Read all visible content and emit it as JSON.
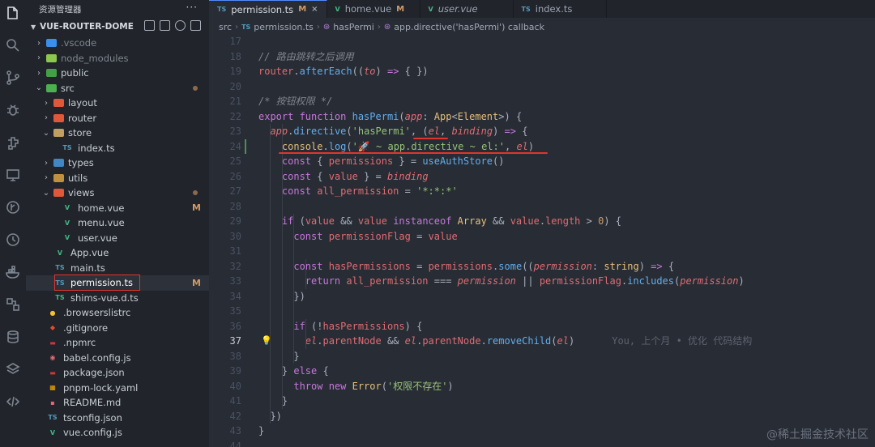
{
  "sidebar": {
    "title": "资源管理器",
    "more": "···",
    "project": "VUE-ROUTER-DOME",
    "tree": [
      {
        "label": ".vscode",
        "chev": "›",
        "icon": "vscode-folder-icon",
        "icon_text": "",
        "icon_color": "#3b8eea",
        "dim": true,
        "level": 1
      },
      {
        "label": "node_modules",
        "chev": "›",
        "icon": "node-folder-icon",
        "icon_text": "",
        "icon_color": "#8cc84b",
        "dim": true,
        "level": 1
      },
      {
        "label": "public",
        "chev": "›",
        "icon": "public-folder-icon",
        "icon_text": "",
        "icon_color": "#43a047",
        "level": 1
      },
      {
        "label": "src",
        "chev": "⌄",
        "icon": "src-folder-icon",
        "icon_text": "",
        "icon_color": "#4caf50",
        "level": 1,
        "dot": true
      },
      {
        "label": "layout",
        "chev": "›",
        "icon": "layout-folder-icon",
        "icon_text": "",
        "icon_color": "#e0583a",
        "level": 2
      },
      {
        "label": "router",
        "chev": "›",
        "icon": "router-folder-icon",
        "icon_text": "",
        "icon_color": "#e0583a",
        "level": 2
      },
      {
        "label": "store",
        "chev": "⌄",
        "icon": "store-folder-icon",
        "icon_text": "",
        "icon_color": "#c0a060",
        "level": 2
      },
      {
        "label": "index.ts",
        "chev": "",
        "icon": "typescript-file-icon",
        "icon_text": "TS",
        "icon_color": "#519aba",
        "level": 3
      },
      {
        "label": "types",
        "chev": "›",
        "icon": "types-folder-icon",
        "icon_text": "",
        "icon_color": "#3f88c5",
        "level": 2
      },
      {
        "label": "utils",
        "chev": "›",
        "icon": "utils-folder-icon",
        "icon_text": "",
        "icon_color": "#c09040",
        "level": 2
      },
      {
        "label": "views",
        "chev": "⌄",
        "icon": "views-folder-icon",
        "icon_text": "",
        "icon_color": "#e0583a",
        "level": 2,
        "dot": true
      },
      {
        "label": "home.vue",
        "chev": "",
        "icon": "vue-file-icon",
        "icon_text": "V",
        "icon_color": "#41b883",
        "level": 3,
        "badge": "M"
      },
      {
        "label": "menu.vue",
        "chev": "",
        "icon": "vue-file-icon",
        "icon_text": "V",
        "icon_color": "#41b883",
        "level": 3
      },
      {
        "label": "user.vue",
        "chev": "",
        "icon": "vue-file-icon",
        "icon_text": "V",
        "icon_color": "#41b883",
        "level": 3
      },
      {
        "label": "App.vue",
        "chev": "",
        "icon": "vue-file-icon",
        "icon_text": "V",
        "icon_color": "#41b883",
        "level": 2
      },
      {
        "label": "main.ts",
        "chev": "",
        "icon": "typescript-file-icon",
        "icon_text": "TS",
        "icon_color": "#519aba",
        "level": 2
      },
      {
        "label": "permission.ts",
        "chev": "",
        "icon": "typescript-file-icon",
        "icon_text": "TS",
        "icon_color": "#519aba",
        "level": 2,
        "badge": "M",
        "selected": true
      },
      {
        "label": "shims-vue.d.ts",
        "chev": "",
        "icon": "typescript-def-icon",
        "icon_text": "TS",
        "icon_color": "#41b883",
        "level": 2
      },
      {
        "label": ".browserslistrc",
        "chev": "",
        "icon": "browserslist-icon",
        "icon_text": "●",
        "icon_color": "#f2c12e",
        "level": 1
      },
      {
        "label": ".gitignore",
        "chev": "",
        "icon": "git-icon",
        "icon_text": "◆",
        "icon_color": "#e44d26",
        "level": 1
      },
      {
        "label": ".npmrc",
        "chev": "",
        "icon": "npm-icon",
        "icon_text": "▬",
        "icon_color": "#cb3837",
        "level": 1
      },
      {
        "label": "babel.config.js",
        "chev": "",
        "icon": "babel-icon",
        "icon_text": "◉",
        "icon_color": "#e06c75",
        "level": 1
      },
      {
        "label": "package.json",
        "chev": "",
        "icon": "npm-package-icon",
        "icon_text": "▬",
        "icon_color": "#cb3837",
        "level": 1
      },
      {
        "label": "pnpm-lock.yaml",
        "chev": "",
        "icon": "pnpm-icon",
        "icon_text": "▦",
        "icon_color": "#f9ad00",
        "level": 1
      },
      {
        "label": "README.md",
        "chev": "",
        "icon": "readme-icon",
        "icon_text": "▪",
        "icon_color": "#e06c75",
        "level": 1
      },
      {
        "label": "tsconfig.json",
        "chev": "",
        "icon": "tsconfig-icon",
        "icon_text": "TS",
        "icon_color": "#519aba",
        "level": 1
      },
      {
        "label": "vue.config.js",
        "chev": "",
        "icon": "vue-config-icon",
        "icon_text": "V",
        "icon_color": "#41b883",
        "level": 1
      }
    ]
  },
  "tabs": [
    {
      "label": "permission.ts",
      "icon_text": "TS",
      "icon_color": "#519aba",
      "badge": "M",
      "active": true,
      "close": "×"
    },
    {
      "label": "home.vue",
      "icon_text": "V",
      "icon_color": "#41b883",
      "badge": "M"
    },
    {
      "label": "user.vue",
      "icon_text": "V",
      "icon_color": "#41b883",
      "italic": true
    },
    {
      "label": "index.ts",
      "icon_text": "TS",
      "icon_color": "#519aba"
    }
  ],
  "breadcrumb": {
    "segments": [
      "src",
      "permission.ts",
      "hasPermi",
      "app.directive('hasPermi') callback"
    ],
    "ts_icon": "TS"
  },
  "code": {
    "blame": "You, 上个月 • 优化 代码结构",
    "lines": [
      {
        "n": "17",
        "tokens": []
      },
      {
        "n": "18",
        "tokens": [
          [
            "com",
            "// 路由跳转之后调用"
          ]
        ]
      },
      {
        "n": "19",
        "tokens": [
          [
            "var",
            "router"
          ],
          [
            "plain",
            "."
          ],
          [
            "fn",
            "afterEach"
          ],
          [
            "plain",
            "(("
          ],
          [
            "param",
            "to"
          ],
          [
            "plain",
            ") "
          ],
          [
            "kw",
            "=>"
          ],
          [
            "plain",
            " { })"
          ]
        ]
      },
      {
        "n": "20",
        "tokens": []
      },
      {
        "n": "21",
        "tokens": [
          [
            "com",
            "/* 按钮权限 */"
          ]
        ]
      },
      {
        "n": "22",
        "tokens": [
          [
            "kw",
            "export function "
          ],
          [
            "fn",
            "hasPermi"
          ],
          [
            "plain",
            "("
          ],
          [
            "param",
            "app"
          ],
          [
            "plain",
            ": "
          ],
          [
            "type",
            "App"
          ],
          [
            "plain",
            "<"
          ],
          [
            "type",
            "Element"
          ],
          [
            "plain",
            ">) {"
          ]
        ]
      },
      {
        "n": "23",
        "tokens": [
          [
            "plain",
            "  "
          ],
          [
            "param",
            "app"
          ],
          [
            "plain",
            "."
          ],
          [
            "fn",
            "directive"
          ],
          [
            "plain",
            "("
          ],
          [
            "str",
            "'hasPermi'"
          ],
          [
            "plain",
            ", ("
          ],
          [
            "param",
            "el"
          ],
          [
            "plain",
            ", "
          ],
          [
            "param",
            "binding"
          ],
          [
            "plain",
            ") "
          ],
          [
            "kw",
            "=>"
          ],
          [
            "plain",
            " {"
          ]
        ]
      },
      {
        "n": "24",
        "tokens": [
          [
            "plain",
            "    "
          ],
          [
            "type",
            "console"
          ],
          [
            "plain",
            "."
          ],
          [
            "fn",
            "log"
          ],
          [
            "plain",
            "("
          ],
          [
            "str",
            "'🚀 ~ app.directive ~ el:'"
          ],
          [
            "plain",
            ", "
          ],
          [
            "param",
            "el"
          ],
          [
            "plain",
            ")"
          ]
        ]
      },
      {
        "n": "25",
        "tokens": [
          [
            "plain",
            "    "
          ],
          [
            "kw",
            "const"
          ],
          [
            "plain",
            " { "
          ],
          [
            "var",
            "permissions"
          ],
          [
            "plain",
            " } = "
          ],
          [
            "fn",
            "useAuthStore"
          ],
          [
            "plain",
            "()"
          ]
        ]
      },
      {
        "n": "26",
        "tokens": [
          [
            "plain",
            "    "
          ],
          [
            "kw",
            "const"
          ],
          [
            "plain",
            " { "
          ],
          [
            "var",
            "value"
          ],
          [
            "plain",
            " } = "
          ],
          [
            "param",
            "binding"
          ]
        ]
      },
      {
        "n": "27",
        "tokens": [
          [
            "plain",
            "    "
          ],
          [
            "kw",
            "const "
          ],
          [
            "var",
            "all_permission"
          ],
          [
            "plain",
            " = "
          ],
          [
            "str",
            "'*:*:*'"
          ]
        ]
      },
      {
        "n": "28",
        "tokens": []
      },
      {
        "n": "29",
        "tokens": [
          [
            "plain",
            "    "
          ],
          [
            "kw",
            "if"
          ],
          [
            "plain",
            " ("
          ],
          [
            "var",
            "value"
          ],
          [
            "plain",
            " && "
          ],
          [
            "var",
            "value"
          ],
          [
            "kw",
            " instanceof "
          ],
          [
            "type",
            "Array"
          ],
          [
            "plain",
            " && "
          ],
          [
            "var",
            "value"
          ],
          [
            "plain",
            "."
          ],
          [
            "prop",
            "length"
          ],
          [
            "plain",
            " > "
          ],
          [
            "num",
            "0"
          ],
          [
            "plain",
            ") {"
          ]
        ]
      },
      {
        "n": "30",
        "tokens": [
          [
            "plain",
            "      "
          ],
          [
            "kw",
            "const "
          ],
          [
            "var",
            "permissionFlag"
          ],
          [
            "plain",
            " = "
          ],
          [
            "var",
            "value"
          ]
        ]
      },
      {
        "n": "31",
        "tokens": []
      },
      {
        "n": "32",
        "tokens": [
          [
            "plain",
            "      "
          ],
          [
            "kw",
            "const "
          ],
          [
            "var",
            "hasPermissions"
          ],
          [
            "plain",
            " = "
          ],
          [
            "var",
            "permissions"
          ],
          [
            "plain",
            "."
          ],
          [
            "fn",
            "some"
          ],
          [
            "plain",
            "(("
          ],
          [
            "param",
            "permission"
          ],
          [
            "plain",
            ": "
          ],
          [
            "type",
            "string"
          ],
          [
            "plain",
            ") "
          ],
          [
            "kw",
            "=>"
          ],
          [
            "plain",
            " {"
          ]
        ]
      },
      {
        "n": "33",
        "tokens": [
          [
            "plain",
            "        "
          ],
          [
            "kw",
            "return "
          ],
          [
            "var",
            "all_permission"
          ],
          [
            "plain",
            " === "
          ],
          [
            "param",
            "permission"
          ],
          [
            "plain",
            " || "
          ],
          [
            "var",
            "permissionFlag"
          ],
          [
            "plain",
            "."
          ],
          [
            "fn",
            "includes"
          ],
          [
            "plain",
            "("
          ],
          [
            "param",
            "permission"
          ],
          [
            "plain",
            ")"
          ]
        ]
      },
      {
        "n": "34",
        "tokens": [
          [
            "plain",
            "      })"
          ]
        ]
      },
      {
        "n": "35",
        "tokens": []
      },
      {
        "n": "36",
        "tokens": [
          [
            "plain",
            "      "
          ],
          [
            "kw",
            "if"
          ],
          [
            "plain",
            " (!"
          ],
          [
            "var",
            "hasPermissions"
          ],
          [
            "plain",
            ") {"
          ]
        ]
      },
      {
        "n": "37",
        "tokens": [
          [
            "plain",
            "        "
          ],
          [
            "param",
            "el"
          ],
          [
            "plain",
            "."
          ],
          [
            "var",
            "parentNode"
          ],
          [
            "plain",
            " && "
          ],
          [
            "param",
            "el"
          ],
          [
            "plain",
            "."
          ],
          [
            "var",
            "parentNode"
          ],
          [
            "plain",
            "."
          ],
          [
            "fn",
            "removeChild"
          ],
          [
            "plain",
            "("
          ],
          [
            "param",
            "el"
          ],
          [
            "plain",
            ")"
          ]
        ],
        "current": true,
        "blame": true
      },
      {
        "n": "38",
        "tokens": [
          [
            "plain",
            "      }"
          ]
        ]
      },
      {
        "n": "39",
        "tokens": [
          [
            "plain",
            "    } "
          ],
          [
            "kw",
            "else"
          ],
          [
            "plain",
            " {"
          ]
        ]
      },
      {
        "n": "40",
        "tokens": [
          [
            "plain",
            "      "
          ],
          [
            "kw",
            "throw new "
          ],
          [
            "type",
            "Error"
          ],
          [
            "plain",
            "("
          ],
          [
            "str",
            "'权限不存在'"
          ],
          [
            "plain",
            ")"
          ]
        ]
      },
      {
        "n": "41",
        "tokens": [
          [
            "plain",
            "    }"
          ]
        ]
      },
      {
        "n": "42",
        "tokens": [
          [
            "plain",
            "  })"
          ]
        ]
      },
      {
        "n": "43",
        "tokens": [
          [
            "plain",
            "}"
          ]
        ]
      },
      {
        "n": "44",
        "tokens": []
      }
    ]
  },
  "watermark": "@稀土掘金技术社区",
  "colors": {
    "annotation_red": "#e0362c",
    "accent": "#528bff"
  }
}
